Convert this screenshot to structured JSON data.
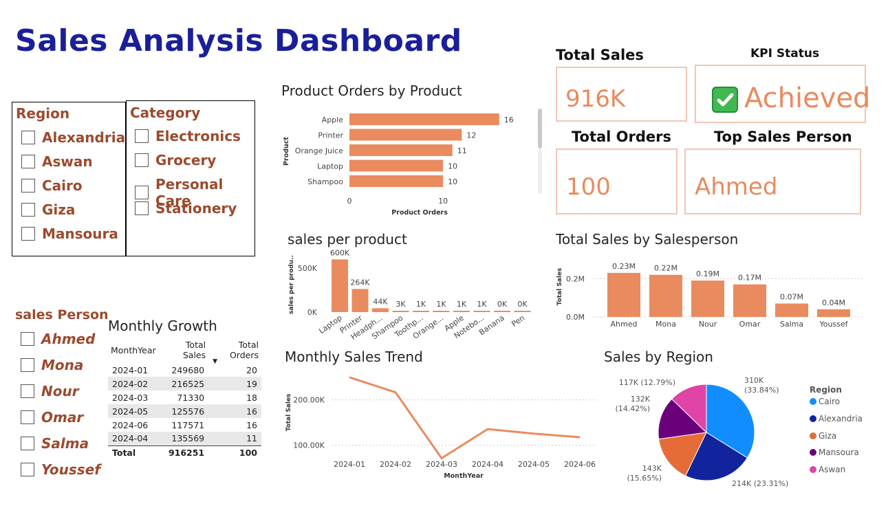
{
  "title": "Sales Analysis Dashboard",
  "region_slicer": {
    "title": "Region",
    "items": [
      "Alexandria",
      "Aswan",
      "Cairo",
      "Giza",
      "Mansoura"
    ]
  },
  "category_slicer": {
    "title": "Category",
    "items": [
      "Electronics",
      "Grocery",
      "Personal Care",
      "Stationery"
    ]
  },
  "salesperson_slicer": {
    "title": "sales Person",
    "items": [
      "Ahmed",
      "Mona",
      "Nour",
      "Omar",
      "Salma",
      "Youssef"
    ]
  },
  "cards": {
    "total_sales_label": "Total Sales",
    "total_sales_value": "916K",
    "kpi_label": "KPI Status",
    "kpi_value": "Achieved",
    "total_orders_label": "Total Orders",
    "total_orders_value": "100",
    "top_person_label": "Top Sales Person",
    "top_person_value": "Ahmed"
  },
  "monthly_growth": {
    "title": "Monthly Growth",
    "columns": [
      "MonthYear",
      "Total Sales",
      "Total Orders"
    ],
    "rows": [
      [
        "2024-01",
        "249680",
        "20"
      ],
      [
        "2024-02",
        "216525",
        "19"
      ],
      [
        "2024-03",
        "71330",
        "18"
      ],
      [
        "2024-05",
        "125576",
        "16"
      ],
      [
        "2024-06",
        "117571",
        "16"
      ],
      [
        "2024-04",
        "135569",
        "11"
      ]
    ],
    "total": [
      "Total",
      "916251",
      "100"
    ]
  },
  "colors": {
    "accent": "#e98b5f",
    "title": "#1a1f99",
    "slicer_text": "#9b4a2e",
    "card_border": "#f0c6b4"
  },
  "chart_data": [
    {
      "id": "product_orders",
      "type": "bar",
      "orientation": "horizontal",
      "title": "Product Orders by Product",
      "xlabel": "Product Orders",
      "ylabel": "Product",
      "categories": [
        "Apple",
        "Printer",
        "Orange Juice",
        "Laptop",
        "Shampoo"
      ],
      "values": [
        16,
        12,
        11,
        10,
        10
      ],
      "data_labels": [
        "16",
        "12",
        "11",
        "10",
        "10"
      ],
      "x_ticks": [
        "0",
        "10"
      ],
      "xlim": [
        0,
        18
      ]
    },
    {
      "id": "sales_per_product",
      "type": "bar",
      "title": "sales per product",
      "ylabel": "sales per produ..",
      "categories": [
        "Laptop",
        "Printer",
        "Headph...",
        "Shampoo",
        "Toothp...",
        "Orange...",
        "Apple",
        "Notebo...",
        "Banana",
        "Pen"
      ],
      "values": [
        600000,
        264000,
        44000,
        3000,
        1000,
        1000,
        1000,
        1000,
        0,
        0
      ],
      "data_labels": [
        "600K",
        "264K",
        "44K",
        "3K",
        "1K",
        "1K",
        "1K",
        "1K",
        "0K",
        "0K"
      ],
      "y_ticks": [
        "0K",
        "500K"
      ],
      "ylim": [
        0,
        720000
      ]
    },
    {
      "id": "sales_by_salesperson",
      "type": "bar",
      "title": "Total Sales by Salesperson",
      "ylabel": "Total Sales",
      "categories": [
        "Ahmed",
        "Mona",
        "Nour",
        "Omar",
        "Salma",
        "Youssef"
      ],
      "values": [
        0.23,
        0.22,
        0.19,
        0.17,
        0.07,
        0.04
      ],
      "data_labels": [
        "0.23M",
        "0.22M",
        "0.19M",
        "0.17M",
        "0.07M",
        "0.04M"
      ],
      "y_ticks": [
        "0.0M",
        "0.2M"
      ],
      "ylim": [
        0,
        0.28
      ],
      "grid": true
    },
    {
      "id": "monthly_sales_trend",
      "type": "line",
      "title": "Monthly Sales Trend",
      "xlabel": "MonthYear",
      "ylabel": "Total Sales",
      "x": [
        "2024-01",
        "2024-02",
        "2024-03",
        "2024-04",
        "2024-05",
        "2024-06"
      ],
      "values": [
        249680,
        216525,
        71330,
        135569,
        125576,
        117571
      ],
      "y_ticks": [
        "100.00K",
        "200.00K"
      ],
      "ylim": [
        60000,
        260000
      ],
      "grid": true
    },
    {
      "id": "sales_by_region",
      "type": "pie",
      "title": "Sales by Region",
      "legend_title": "Region",
      "legend_position": "right",
      "categories": [
        "Cairo",
        "Alexandria",
        "Giza",
        "Mansoura",
        "Aswan"
      ],
      "values": [
        33.84,
        23.31,
        15.65,
        14.42,
        12.79
      ],
      "data_labels": [
        "310K\n(33.84%)",
        "214K (23.31%)",
        "143K\n(15.65%)",
        "132K\n(14.42%)",
        "117K (12.79%)"
      ],
      "colors": [
        "#118dff",
        "#12239e",
        "#e66c37",
        "#6b007b",
        "#e044a7"
      ]
    }
  ]
}
